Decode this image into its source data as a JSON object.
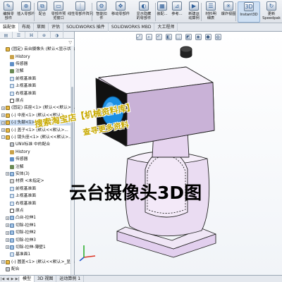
{
  "ribbon": {
    "buttons": [
      {
        "label": "编辑零\n部件",
        "icon": "✎",
        "active": false
      },
      {
        "label": "插入零部件",
        "icon": "⊕",
        "active": false
      },
      {
        "label": "配合",
        "icon": "⧉",
        "active": false
      },
      {
        "label": "零部件预\n览窗口",
        "icon": "▭",
        "active": false
      },
      {
        "label": "线性零部件阵列",
        "icon": "⋮",
        "active": false
      },
      {
        "label": "智能扣\n件",
        "icon": "⚙",
        "active": false
      },
      {
        "label": "移动零部件",
        "icon": "✥",
        "active": false
      },
      {
        "label": "显示隐藏\n的零部件",
        "icon": "◐",
        "active": false
      },
      {
        "label": "装配...",
        "icon": "▦",
        "active": false
      },
      {
        "label": "参考...",
        "icon": "⊿",
        "active": false
      },
      {
        "label": "新建运\n动算例",
        "icon": "▶",
        "active": false
      },
      {
        "label": "材料明\n细表",
        "icon": "☰",
        "active": false
      },
      {
        "label": "爆炸视图",
        "icon": "✳",
        "active": false
      },
      {
        "label": "Instant3D",
        "icon": "3D",
        "active": true
      },
      {
        "label": "更新\nSpeedpak",
        "icon": "↻",
        "active": false
      }
    ]
  },
  "command_tabs": [
    "装配体",
    "布局",
    "草图",
    "评估",
    "SOLIDWORKS 插件",
    "SOLIDWORKS MBD",
    "大工程师"
  ],
  "feature_tree": {
    "items": [
      {
        "label": "(固定) 云台摄像头 (默认<显示状态-1>)",
        "indent": 0,
        "toggle": "",
        "icon": "part",
        "selected": false
      },
      {
        "label": "History",
        "indent": 1,
        "toggle": "",
        "icon": "hist",
        "selected": false
      },
      {
        "label": "传感器",
        "indent": 1,
        "toggle": "",
        "icon": "sens",
        "selected": false
      },
      {
        "label": "注解",
        "indent": 1,
        "toggle": "",
        "icon": "note",
        "selected": false
      },
      {
        "label": "前视基准面",
        "indent": 1,
        "toggle": "",
        "icon": "plane",
        "selected": false
      },
      {
        "label": "上视基准面",
        "indent": 1,
        "toggle": "",
        "icon": "plane",
        "selected": false
      },
      {
        "label": "右视基准面",
        "indent": 1,
        "toggle": "",
        "icon": "plane",
        "selected": false
      },
      {
        "label": "原点",
        "indent": 1,
        "toggle": "",
        "icon": "orig",
        "selected": false
      },
      {
        "label": "(固定) 底座<1> (默认<<默认>...",
        "indent": 0,
        "toggle": "+",
        "icon": "part",
        "selected": false
      },
      {
        "label": "(-) 中座<1> (默认<<默认>...",
        "indent": 0,
        "toggle": "+",
        "icon": "part",
        "selected": false
      },
      {
        "label": "(-) 头部<1> (默认<<默认>...",
        "indent": 0,
        "toggle": "+",
        "icon": "part",
        "selected": true
      },
      {
        "label": "(-) 盖子<1> (默认<<默认>...",
        "indent": 0,
        "toggle": "+",
        "icon": "part",
        "selected": false
      },
      {
        "label": "(-) 镜头座<1> (默认<<默认>...",
        "indent": 0,
        "toggle": "−",
        "icon": "part",
        "selected": false
      },
      {
        "label": "UNV标准 中的配合",
        "indent": 1,
        "toggle": "",
        "icon": "mate",
        "selected": false
      },
      {
        "label": "History",
        "indent": 1,
        "toggle": "",
        "icon": "hist",
        "selected": false
      },
      {
        "label": "传感器",
        "indent": 1,
        "toggle": "",
        "icon": "sens",
        "selected": false
      },
      {
        "label": "注解",
        "indent": 1,
        "toggle": "",
        "icon": "note",
        "selected": false
      },
      {
        "label": "实体(3)",
        "indent": 1,
        "toggle": "+",
        "icon": "feat",
        "selected": false
      },
      {
        "label": "材质 <未指定>",
        "indent": 1,
        "toggle": "",
        "icon": "mat",
        "selected": false
      },
      {
        "label": "前视基准面",
        "indent": 1,
        "toggle": "",
        "icon": "plane",
        "selected": false
      },
      {
        "label": "上视基准面",
        "indent": 1,
        "toggle": "",
        "icon": "plane",
        "selected": false
      },
      {
        "label": "右视基准面",
        "indent": 1,
        "toggle": "",
        "icon": "plane",
        "selected": false
      },
      {
        "label": "原点",
        "indent": 1,
        "toggle": "",
        "icon": "orig",
        "selected": false
      },
      {
        "label": "凸台-拉伸1",
        "indent": 1,
        "toggle": "+",
        "icon": "feat",
        "selected": false
      },
      {
        "label": "切除-拉伸1",
        "indent": 1,
        "toggle": "+",
        "icon": "feat",
        "selected": false
      },
      {
        "label": "切除-拉伸2",
        "indent": 1,
        "toggle": "+",
        "icon": "feat",
        "selected": false
      },
      {
        "label": "切除-拉伸3",
        "indent": 1,
        "toggle": "+",
        "icon": "feat",
        "selected": false
      },
      {
        "label": "切除-拉伸-薄壁1",
        "indent": 1,
        "toggle": "+",
        "icon": "feat",
        "selected": false
      },
      {
        "label": "基准面1",
        "indent": 1,
        "toggle": "",
        "icon": "plane",
        "selected": false
      },
      {
        "label": "(-) 圆盖<1> (默认<<默认>_显示",
        "indent": 0,
        "toggle": "+",
        "icon": "part",
        "selected": false
      },
      {
        "label": "配合",
        "indent": 0,
        "toggle": "",
        "icon": "mate",
        "selected": false
      }
    ]
  },
  "viewport": {
    "watermark_line1": "搜索淘宝店【机械资料库】",
    "watermark_line2": "查寻更多资料",
    "overlay_title": "云台摄像头3D图"
  },
  "bottom_tabs": [
    "模型",
    "3D 视图",
    "运动算例 1"
  ],
  "colors": {
    "housing": "#e9d8f1",
    "housing_shade": "#c9b2d7",
    "lens": "#1b8fe3",
    "outline": "#222222",
    "watermark": "#c8a900",
    "selection": "#c8dbf2"
  }
}
